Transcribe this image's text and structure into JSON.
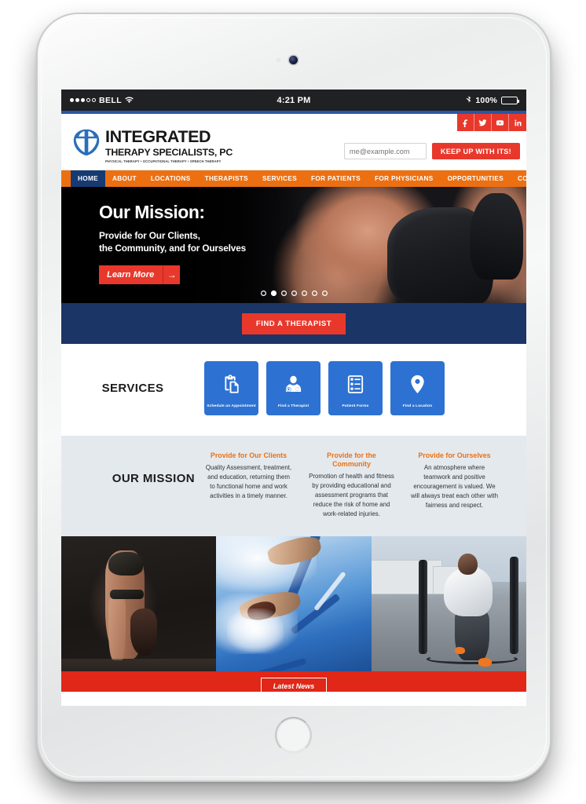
{
  "device": {
    "type": "white-tablet",
    "camera_icon": "camera-lens-icon",
    "home_button": "home-button"
  },
  "status_bar": {
    "carrier": "BELL",
    "signal_bars_filled": 3,
    "signal_bars_total": 5,
    "wifi_icon": "wifi-icon",
    "time": "4:21 PM",
    "bluetooth_icon": "bluetooth-icon",
    "battery_percent": "100%",
    "battery_icon": "battery-full-icon"
  },
  "header": {
    "logo": {
      "mark_icon": "shield-cross-logo-icon",
      "line1": "INTEGRATED",
      "line2": "THERAPY SPECIALISTS, PC",
      "line3": "PHYSICAL THERAPY • OCCUPATIONAL THERAPY • SPEECH THERAPY"
    },
    "social": [
      {
        "name": "facebook-icon",
        "label": "Facebook"
      },
      {
        "name": "twitter-icon",
        "label": "Twitter"
      },
      {
        "name": "youtube-icon",
        "label": "YouTube"
      },
      {
        "name": "linkedin-icon",
        "label": "LinkedIn"
      }
    ],
    "email_placeholder": "me@example.com",
    "email_value": "",
    "signup_button": "KEEP UP WITH ITS!"
  },
  "nav": {
    "items": [
      {
        "label": "HOME",
        "active": true
      },
      {
        "label": "ABOUT",
        "active": false
      },
      {
        "label": "LOCATIONS",
        "active": false
      },
      {
        "label": "THERAPISTS",
        "active": false
      },
      {
        "label": "SERVICES",
        "active": false
      },
      {
        "label": "FOR PATIENTS",
        "active": false
      },
      {
        "label": "FOR PHYSICIANS",
        "active": false
      },
      {
        "label": "OPPORTUNITIES",
        "active": false
      },
      {
        "label": "CONTACT",
        "active": false
      }
    ]
  },
  "hero": {
    "title": "Our Mission:",
    "subtitle_line1": "Provide for Our Clients,",
    "subtitle_line2": "the Community, and for Ourselves",
    "button_label": "Learn More",
    "button_arrow": "arrow-right-icon",
    "slide_count": 7,
    "active_slide": 2
  },
  "cta": {
    "find_therapist_label": "FIND A THERAPIST"
  },
  "services": {
    "heading": "SERVICES",
    "tiles": [
      {
        "icon": "clipboard-document-icon",
        "label": "Schedule an Appointment"
      },
      {
        "icon": "doctor-stethoscope-icon",
        "label": "Find a Therapist"
      },
      {
        "icon": "form-checklist-icon",
        "label": "Patient Forms"
      },
      {
        "icon": "map-pin-icon",
        "label": "Find a Location"
      }
    ]
  },
  "mission": {
    "heading": "OUR MISSION",
    "columns": [
      {
        "title": "Provide for Our Clients",
        "body": "Quality Assessment, treatment, and education, returning them to functional home and work activities in a timely manner."
      },
      {
        "title": "Provide for the Community",
        "body": "Promotion of health and fitness by providing educational and assessment programs that reduce the risk of home and work-related injuries."
      },
      {
        "title": "Provide for Ourselves",
        "body": "An atmosphere where teamwork and positive encouragement is valued. We will always treat each other with fairness and respect."
      }
    ]
  },
  "photo_strip": [
    {
      "name": "photo-yoga",
      "alt": "Person in standing forward fold yoga pose"
    },
    {
      "name": "photo-swimming",
      "alt": "Swimmer in pool lane"
    },
    {
      "name": "photo-sled-push",
      "alt": "Athlete pushing weighted sled outdoors"
    }
  ],
  "news": {
    "latest_news_label": "Latest News"
  },
  "colors": {
    "brand_orange": "#ec7012",
    "brand_red": "#e8382c",
    "brand_navy": "#1b3566",
    "nav_active_navy": "#183a72",
    "service_blue": "#2d72d2",
    "mission_bg": "#e4e9ee",
    "news_band_red": "#e02718",
    "top_accent_blue": "#2a55a5"
  }
}
